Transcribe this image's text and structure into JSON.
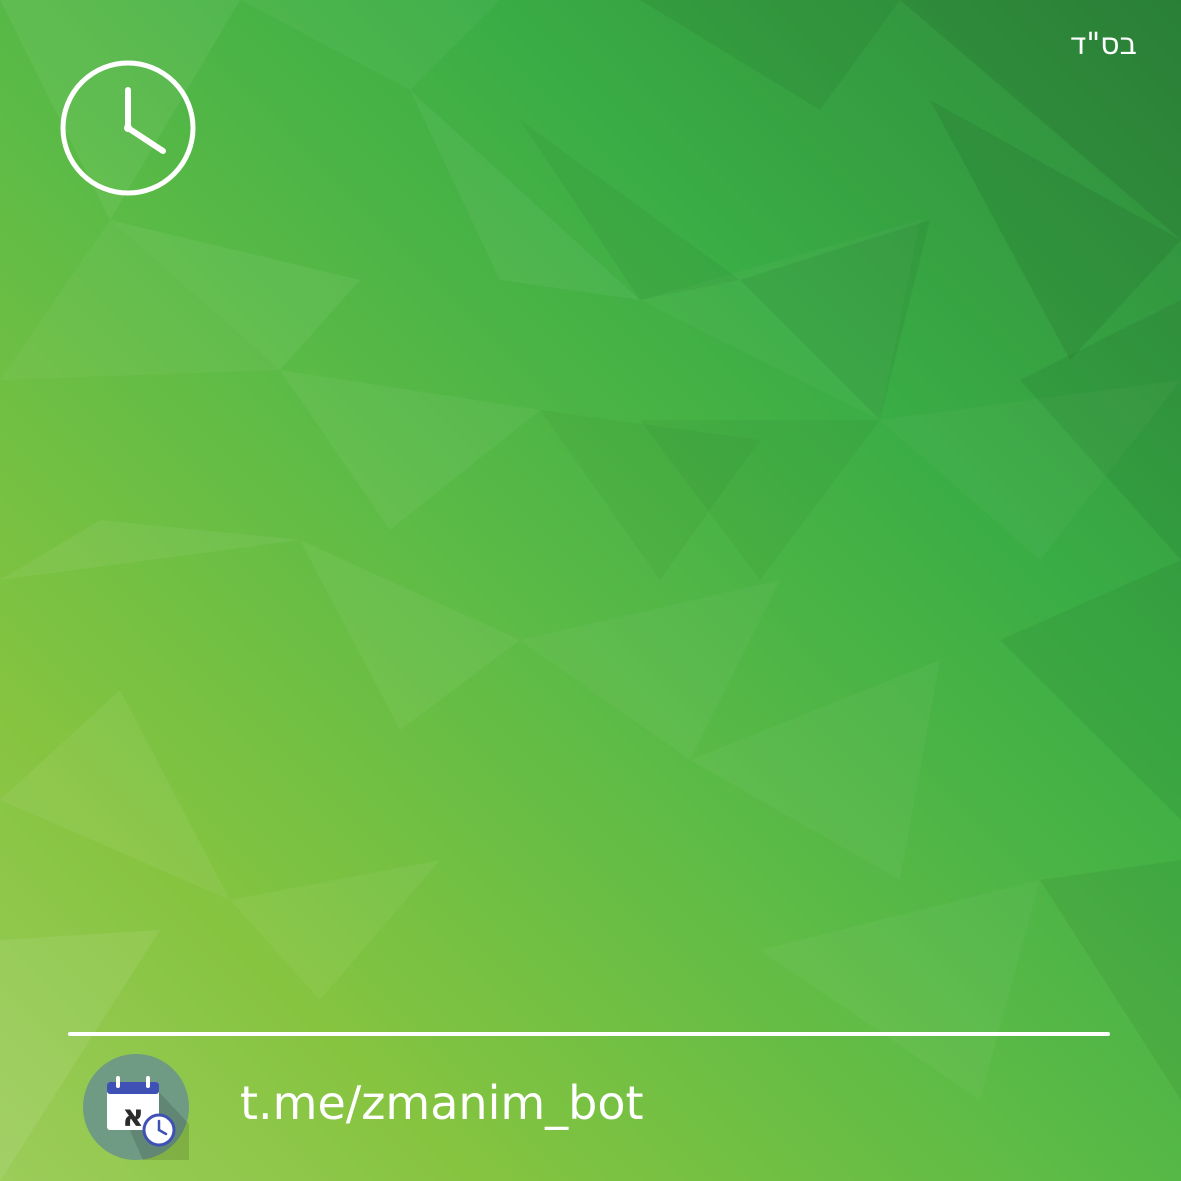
{
  "header": {
    "corner_text": "בס\"ד"
  },
  "icons": {
    "clock": "clock-icon",
    "bot_logo": "calendar-clock-logo-icon",
    "logo_letter": "א"
  },
  "footer": {
    "link_text": "t.me/zmanim_bot"
  },
  "colors": {
    "background_dark": "#2e8a3c",
    "background_mid": "#3aad45",
    "background_light": "#9ccc5a",
    "foreground": "#ffffff",
    "logo_circle": "#6f9a84",
    "logo_calendar_header": "#3f51b5"
  }
}
